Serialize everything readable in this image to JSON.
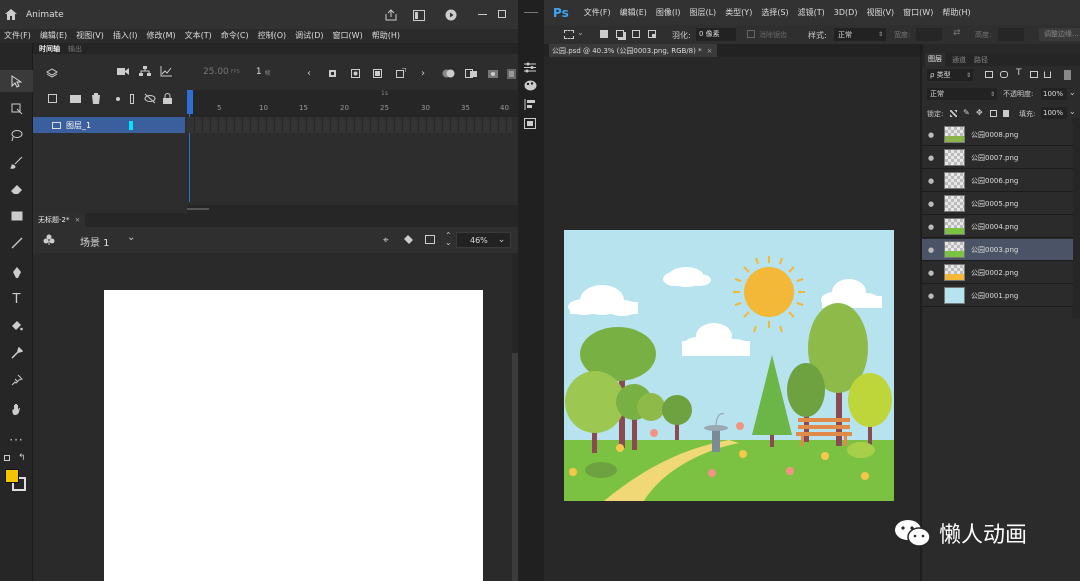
{
  "animate": {
    "app_name": "Animate",
    "menu": [
      "文件(F)",
      "编辑(E)",
      "视图(V)",
      "插入(I)",
      "修改(M)",
      "文本(T)",
      "命令(C)",
      "控制(O)",
      "调试(D)",
      "窗口(W)",
      "帮助(H)"
    ],
    "panel_tabs": [
      "时间轴",
      "输出"
    ],
    "fps": "25.00",
    "fps_unit": "FPS",
    "frame": "1",
    "frame_unit": "帧",
    "ruler_marks": [
      "1s",
      "5",
      "10",
      "15",
      "20",
      "25",
      "30",
      "35",
      "40"
    ],
    "layer_name": "图层_1",
    "doc_tab": "无标题-2*",
    "scene": "场景 1",
    "zoom": "46%",
    "colors": {
      "stroke": "#000000",
      "fill": "#f5c400"
    }
  },
  "photoshop": {
    "logo": "Ps",
    "menu": [
      "文件(F)",
      "编辑(E)",
      "图像(I)",
      "图层(L)",
      "类型(Y)",
      "选择(S)",
      "滤镜(T)",
      "3D(D)",
      "视图(V)",
      "窗口(W)",
      "帮助(H)"
    ],
    "options": {
      "feather_label": "羽化:",
      "feather_value": "0 像素",
      "antialias": "消除锯齿",
      "style_label": "样式:",
      "style_value": "正常",
      "width_label": "宽度:",
      "height_label": "高度:",
      "refine": "调整边缘..."
    },
    "doc_tab": "公园.psd @ 40.3% (公园0003.png, RGB/8) *",
    "layers_panel": {
      "tabs": [
        "图层",
        "通道",
        "路径"
      ],
      "filter": "ρ 类型",
      "blend_mode": "正常",
      "opacity_label": "不透明度:",
      "opacity_value": "100%",
      "lock_label": "锁定:",
      "fill_label": "填充:",
      "fill_value": "100%",
      "layers": [
        "公园0008.png",
        "公园0007.png",
        "公园0006.png",
        "公园0005.png",
        "公园0004.png",
        "公园0003.png",
        "公园0002.png",
        "公园0001.png"
      ],
      "selected_index": 5
    }
  },
  "watermark": "懒人动画"
}
